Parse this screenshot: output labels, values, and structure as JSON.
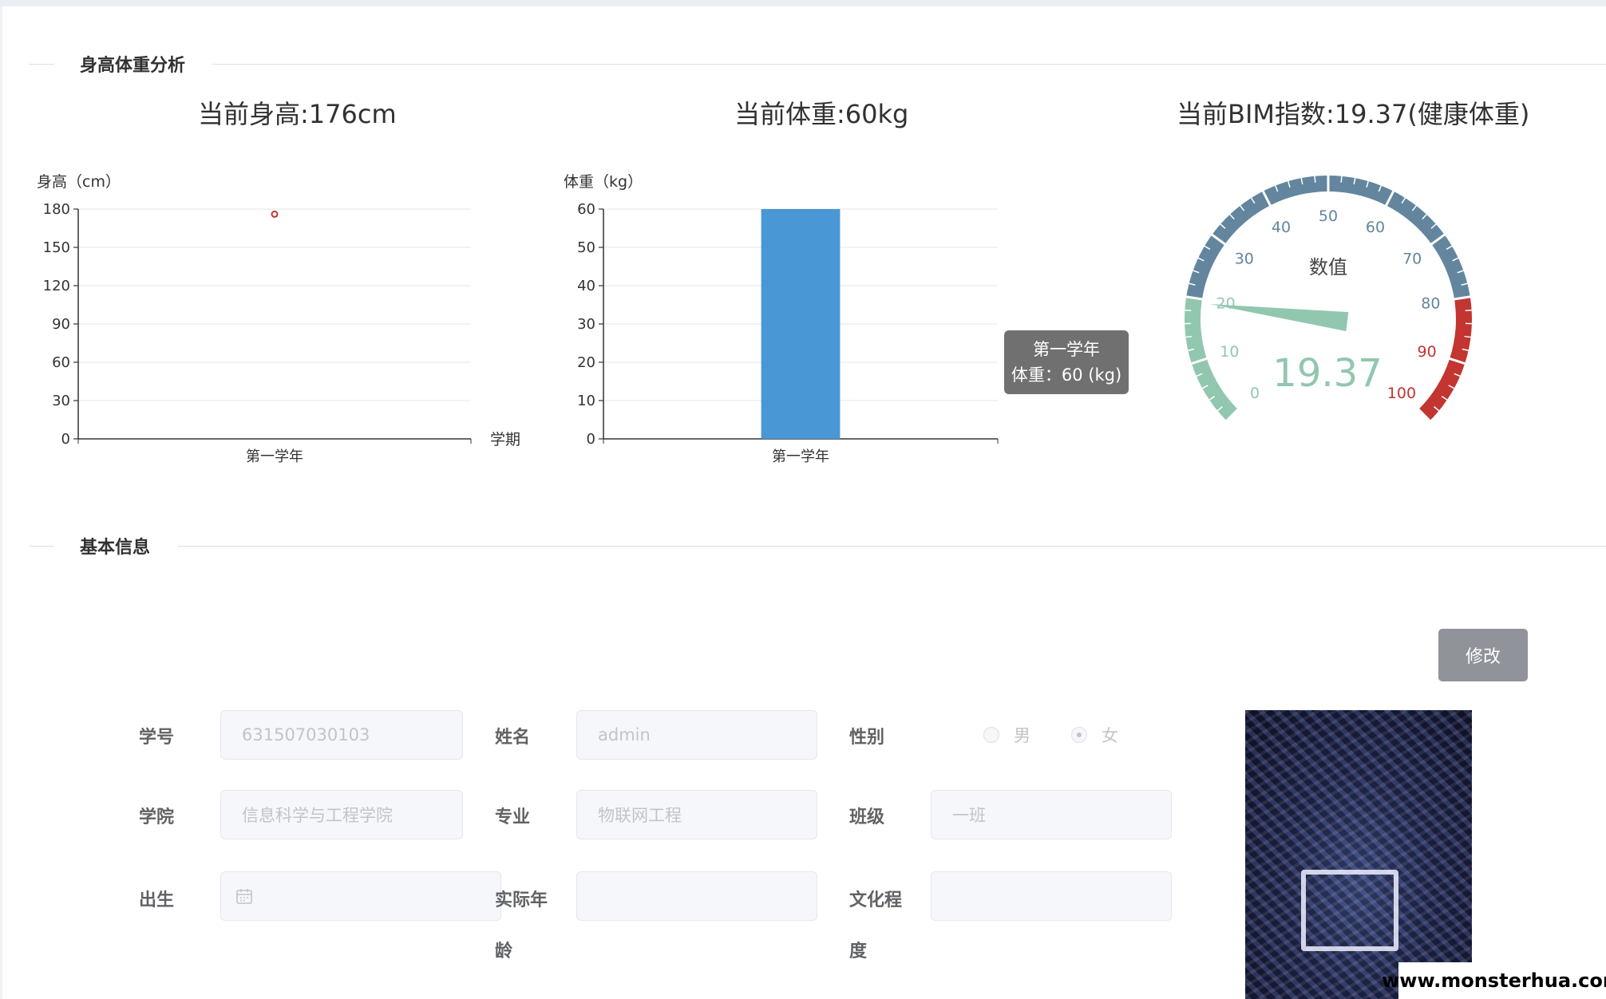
{
  "sections": {
    "analysis_title": "身高体重分析",
    "basic_title": "基本信息"
  },
  "summary": {
    "height": "当前身高:176cm",
    "weight": "当前体重:60kg",
    "bmi": "当前BIM指数:19.37(健康体重)"
  },
  "chart_data": [
    {
      "type": "scatter",
      "ylabel": "身高（cm）",
      "xlabel": "学期",
      "categories": [
        "第一学年"
      ],
      "values": [
        176
      ],
      "ylim": [
        0,
        180
      ],
      "yticks": [
        0,
        30,
        60,
        90,
        120,
        150,
        180
      ],
      "grid": true,
      "color": "#c23531"
    },
    {
      "type": "bar",
      "ylabel": "体重（kg）",
      "categories": [
        "第一学年"
      ],
      "values": [
        60
      ],
      "ylim": [
        0,
        60
      ],
      "yticks": [
        0,
        10,
        20,
        30,
        40,
        50,
        60
      ],
      "grid": true,
      "color": "#4a97d6",
      "tooltip": {
        "category": "第一学年",
        "text": "体重：60 (kg)"
      }
    },
    {
      "type": "gauge",
      "name": "数值",
      "value": 19.37,
      "value_label": "19.37",
      "range": [
        0,
        100
      ],
      "ticks": [
        "0",
        "10",
        "20",
        "30",
        "40",
        "50",
        "60",
        "70",
        "80",
        "90",
        "100"
      ],
      "bands": [
        {
          "to": 0.2,
          "color": "#91c7ae"
        },
        {
          "to": 0.8,
          "color": "#63869e"
        },
        {
          "to": 1.0,
          "color": "#c23531"
        }
      ]
    }
  ],
  "toolbar": {
    "edit_label": "修改"
  },
  "form": {
    "student_id": {
      "label": "学号",
      "placeholder": "631507030103"
    },
    "name": {
      "label": "姓名",
      "placeholder": "admin"
    },
    "gender": {
      "label": "性别",
      "options": [
        "男",
        "女"
      ],
      "selected": "女"
    },
    "college": {
      "label": "学院",
      "placeholder": "信息科学与工程学院"
    },
    "major": {
      "label": "专业",
      "placeholder": "物联网工程"
    },
    "class": {
      "label": "班级",
      "placeholder": "一班"
    },
    "birth": {
      "label": "出生",
      "icon": "calendar-icon"
    },
    "age": {
      "label_line1": "实际年",
      "label_line2": "龄"
    },
    "education": {
      "label_line1": "文化程",
      "label_line2": "度"
    }
  },
  "watermark": "www.monsterhua.com"
}
